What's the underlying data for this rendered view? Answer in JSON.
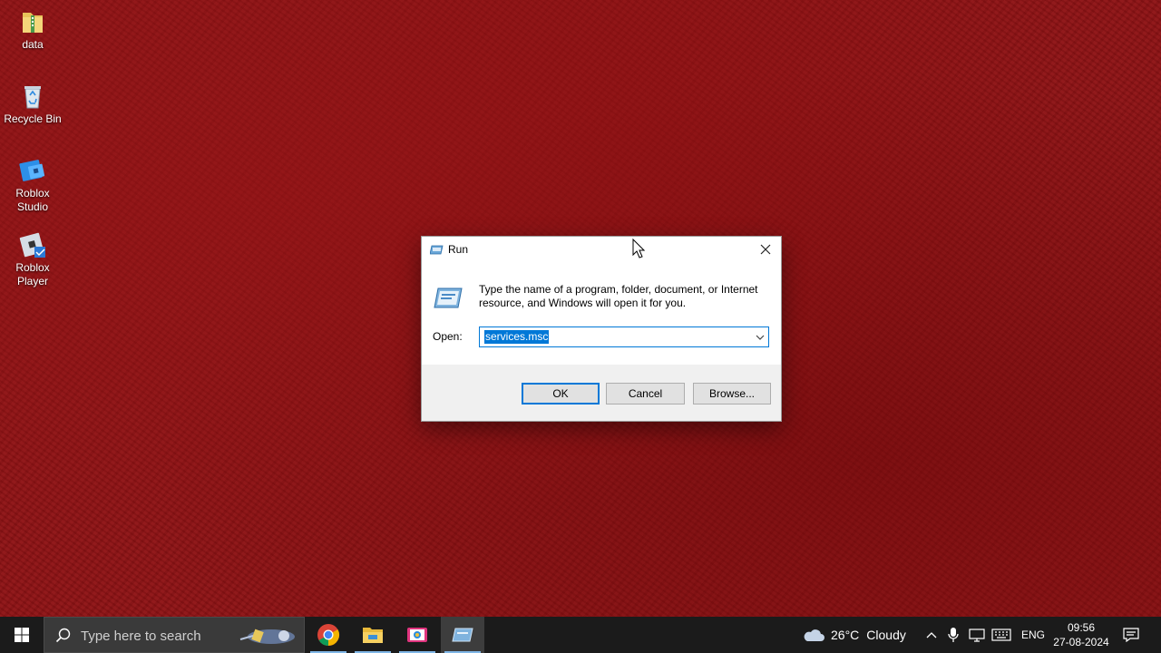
{
  "desktop": {
    "icons": [
      {
        "label": "data"
      },
      {
        "label": "Recycle Bin"
      },
      {
        "label": "Roblox Studio"
      },
      {
        "label": "Roblox Player"
      }
    ]
  },
  "run_dialog": {
    "title": "Run",
    "description": "Type the name of a program, folder, document, or Internet resource, and Windows will open it for you.",
    "open_label": "Open:",
    "open_value": "services.msc",
    "ok_label": "OK",
    "cancel_label": "Cancel",
    "browse_label": "Browse..."
  },
  "taskbar": {
    "search_placeholder": "Type here to search",
    "pinned_apps": [
      "chrome-icon",
      "file-explorer-icon",
      "photos-icon",
      "run-icon"
    ],
    "weather_temp": "26°C",
    "weather_condition": "Cloudy",
    "language": "ENG",
    "time": "09:56",
    "date": "27-08-2024"
  },
  "colors": {
    "accent": "#0078d7",
    "wallpaper": "#8e1214",
    "taskbar": "#1b1b1b"
  }
}
